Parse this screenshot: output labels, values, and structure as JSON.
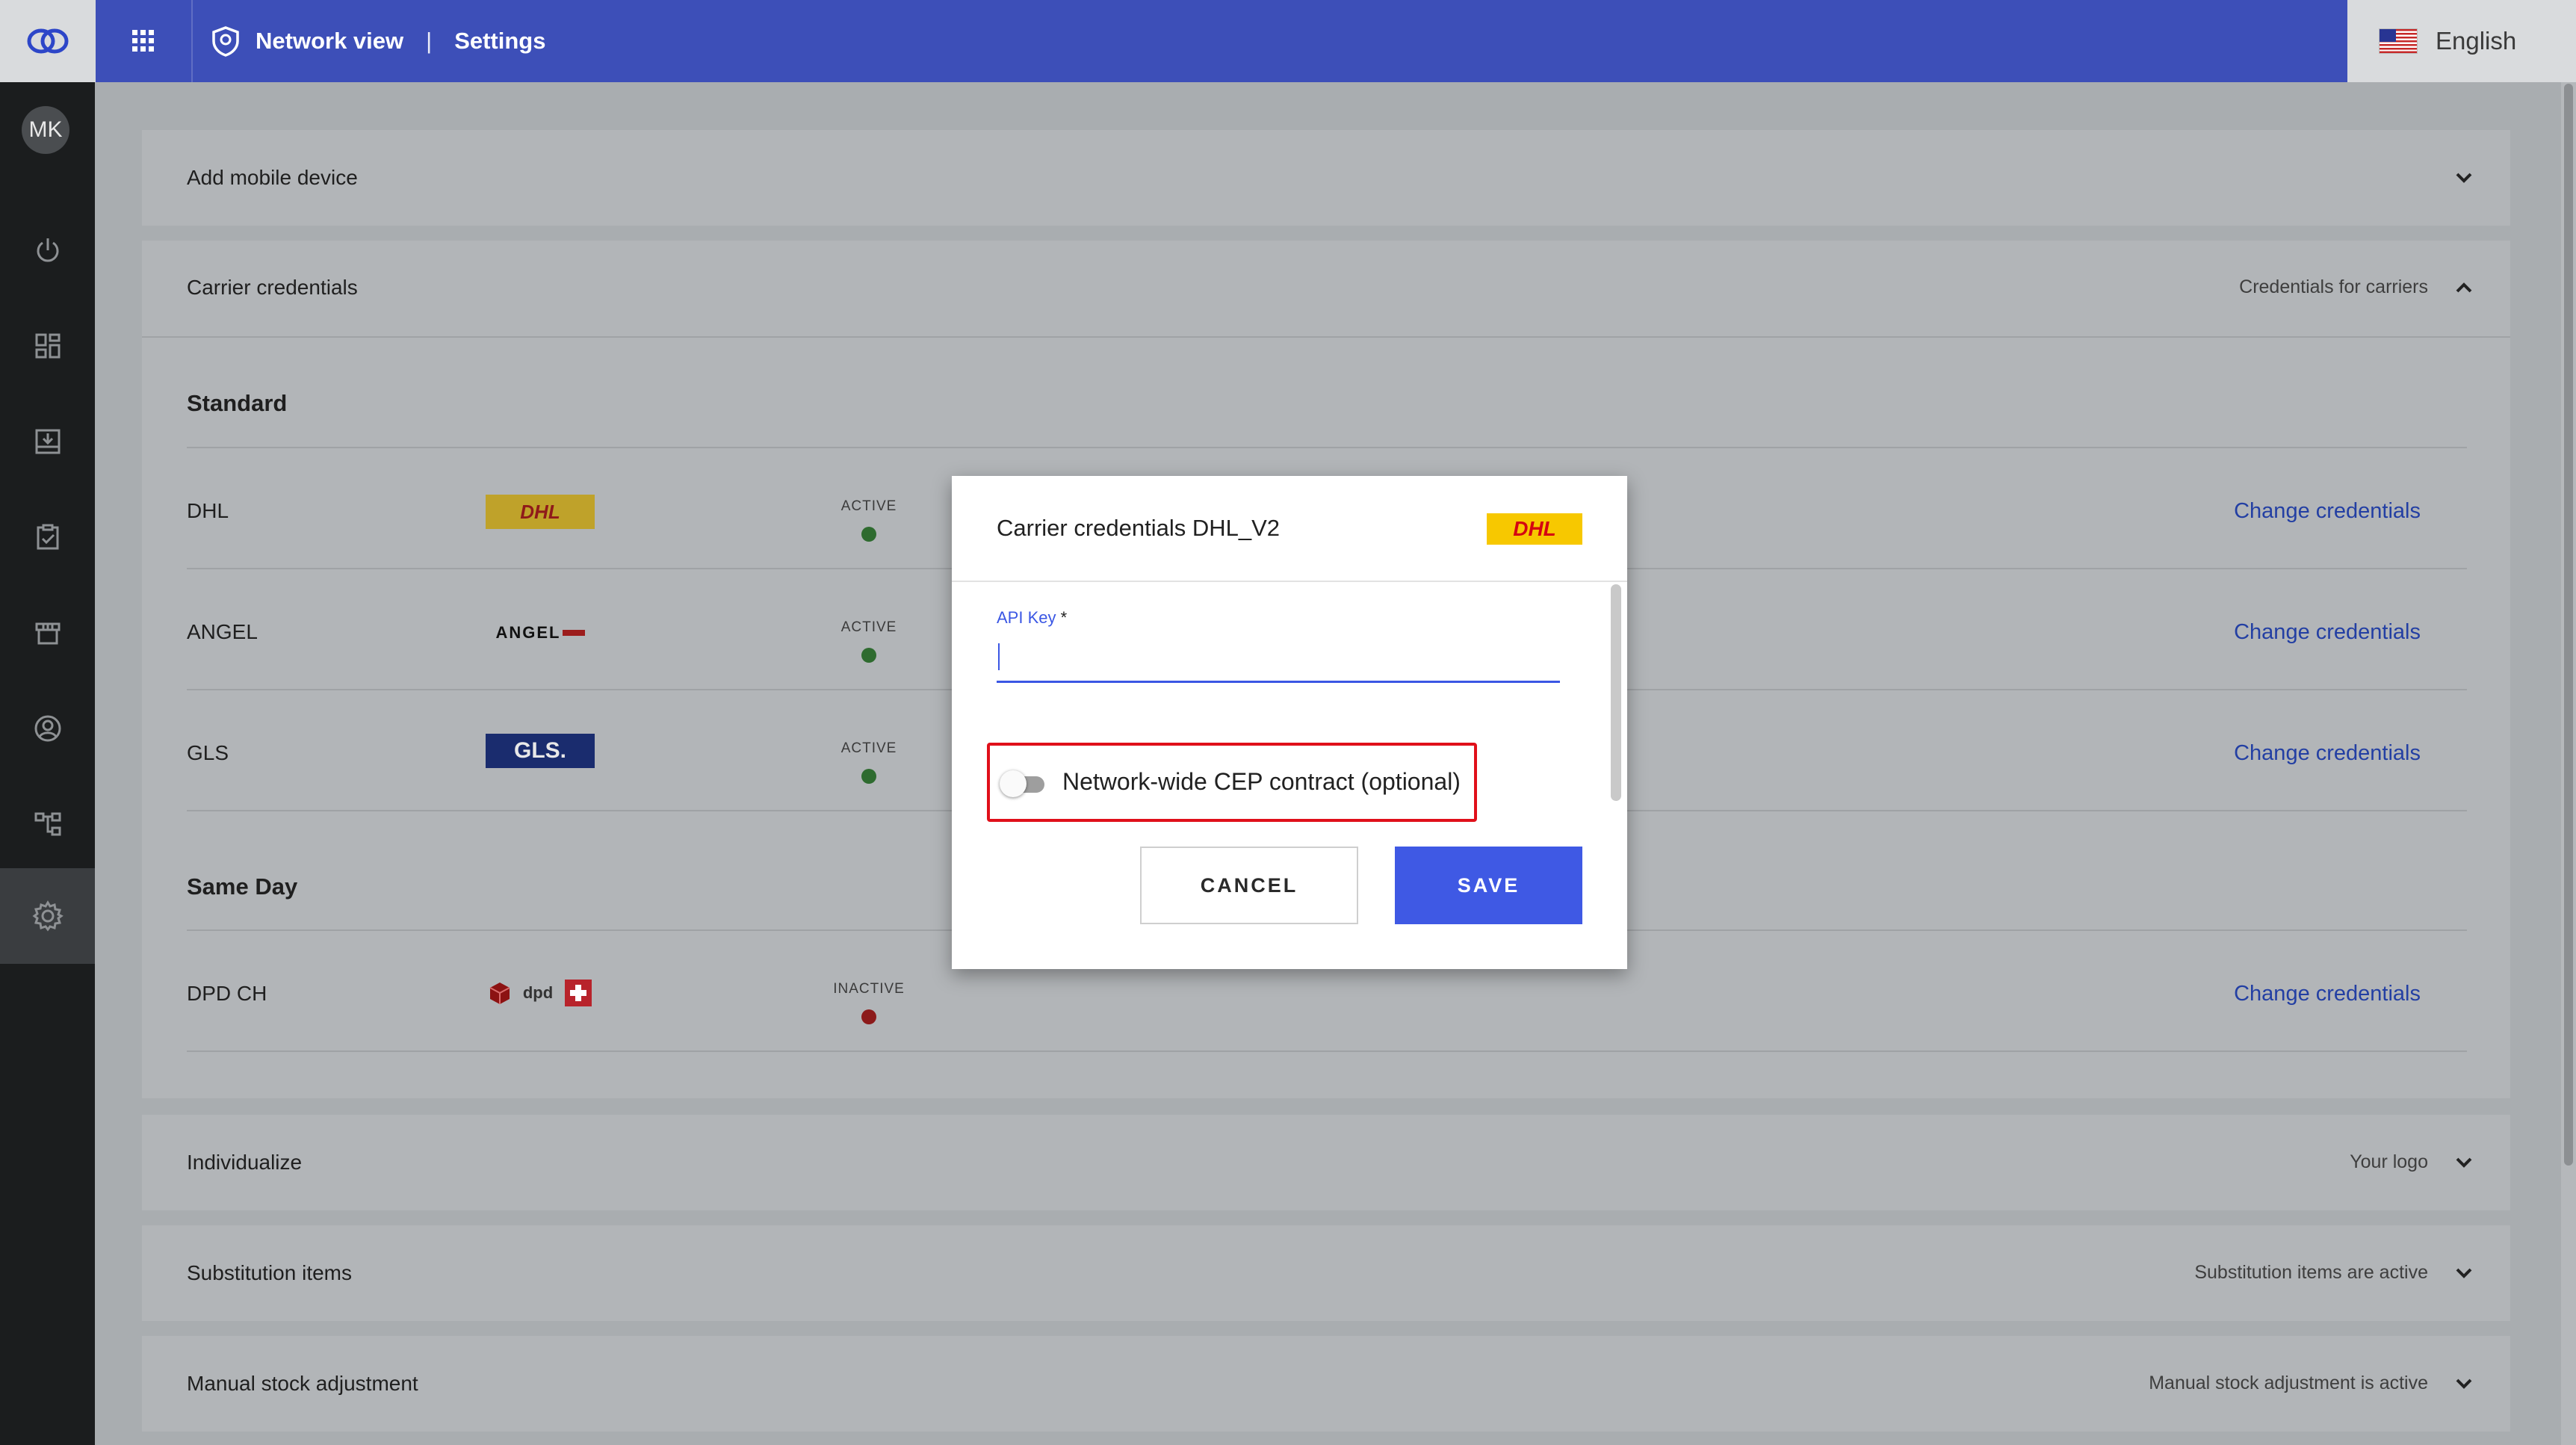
{
  "header": {
    "app_section": "Network view",
    "separator": "|",
    "page": "Settings",
    "language": "English"
  },
  "user": {
    "initials": "MK"
  },
  "sidebar": {
    "items": [
      {
        "icon": "power-icon"
      },
      {
        "icon": "dashboard-icon"
      },
      {
        "icon": "inbox-download-icon"
      },
      {
        "icon": "clipboard-check-icon"
      },
      {
        "icon": "store-icon"
      },
      {
        "icon": "account-circle-icon"
      },
      {
        "icon": "hierarchy-icon"
      },
      {
        "icon": "gear-icon",
        "active": true
      }
    ]
  },
  "panels": {
    "add_mobile": {
      "title": "Add mobile device"
    },
    "carrier": {
      "title": "Carrier credentials",
      "info": "Credentials for carriers",
      "standard_heading": "Standard",
      "same_day_heading": "Same Day",
      "rows": [
        {
          "name": "DHL",
          "logo": "DHL",
          "status": "ACTIVE",
          "status_color": "#2e7d32",
          "link": "Change credentials"
        },
        {
          "name": "ANGEL",
          "logo": "ANGEL",
          "status": "ACTIVE",
          "status_color": "#2e7d32",
          "link": "Change credentials"
        },
        {
          "name": "GLS",
          "logo": "GLS.",
          "status": "ACTIVE",
          "status_color": "#2e7d32",
          "link": "Change credentials"
        },
        {
          "name": "DPD CH",
          "logo": "dpd",
          "status": "INACTIVE",
          "status_color": "#b71c1c",
          "link": "Change credentials"
        }
      ]
    },
    "individualize": {
      "title": "Individualize",
      "info": "Your logo"
    },
    "substitution": {
      "title": "Substitution items",
      "info": "Substitution items are active"
    },
    "manual_stock": {
      "title": "Manual stock adjustment",
      "info": "Manual stock adjustment is active"
    }
  },
  "dialog": {
    "title": "Carrier credentials DHL_V2",
    "logo": "DHL",
    "api_key_label": "API Key",
    "required_mark": "*",
    "api_key_value": "",
    "toggle_label": "Network-wide CEP contract (optional)",
    "toggle_on": false,
    "cancel_label": "CANCEL",
    "save_label": "SAVE"
  },
  "colors": {
    "topbar": "#3d4fb8",
    "accent": "#3f59e4",
    "link": "#233fa3",
    "active_dot": "#2e7d32",
    "inactive_dot": "#b71c1c",
    "dhl_yellow": "#f7c800",
    "dhl_red": "#d40511",
    "gls_blue": "#152f8a",
    "highlight_border": "#e0101a"
  }
}
